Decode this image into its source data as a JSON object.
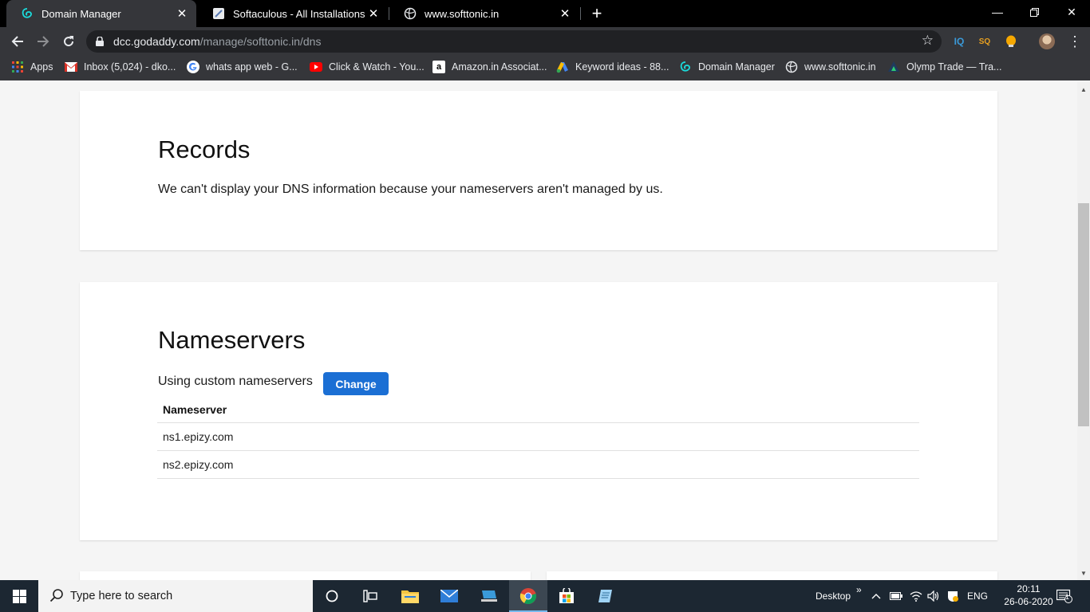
{
  "browser": {
    "tabs": [
      {
        "title": "Domain Manager",
        "active": true
      },
      {
        "title": "Softaculous - All Installations",
        "active": false
      },
      {
        "title": "www.softtonic.in",
        "active": false
      }
    ],
    "new_tab_icon": "plus",
    "url_domain": "dcc.godaddy.com",
    "url_path": "/manage/softtonic.in/dns",
    "extensions": [
      "IQ",
      "SQ",
      "bulb"
    ],
    "bookmarks": [
      {
        "label": "Apps",
        "icon": "apps-grid-icon"
      },
      {
        "label": "Inbox (5,024) - dko...",
        "icon": "gmail-icon"
      },
      {
        "label": "whats app web - G...",
        "icon": "google-icon"
      },
      {
        "label": "Click & Watch - You...",
        "icon": "youtube-icon"
      },
      {
        "label": "Amazon.in Associat...",
        "icon": "amazon-icon"
      },
      {
        "label": "Keyword ideas - 88...",
        "icon": "google-ads-icon"
      },
      {
        "label": "Domain Manager",
        "icon": "godaddy-icon"
      },
      {
        "label": "www.softtonic.in",
        "icon": "globe-icon"
      },
      {
        "label": "Olymp Trade — Tra...",
        "icon": "olymp-icon"
      }
    ]
  },
  "records": {
    "title": "Records",
    "message": "We can't display your DNS information because your nameservers aren't managed by us."
  },
  "nameservers": {
    "title": "Nameservers",
    "status": "Using custom nameservers",
    "change_label": "Change",
    "column_header": "Nameserver",
    "rows": [
      "ns1.epizy.com",
      "ns2.epizy.com"
    ]
  },
  "taskbar": {
    "search_placeholder": "Type here to search",
    "desktop_label": "Desktop",
    "chevrons": "»",
    "language": "ENG",
    "time": "20:11",
    "date": "26-06-2020",
    "notification_count": "1"
  },
  "colors": {
    "change_button": "#1b6fd4",
    "chrome_dark": "#35363a",
    "taskbar": "#1c2732"
  }
}
